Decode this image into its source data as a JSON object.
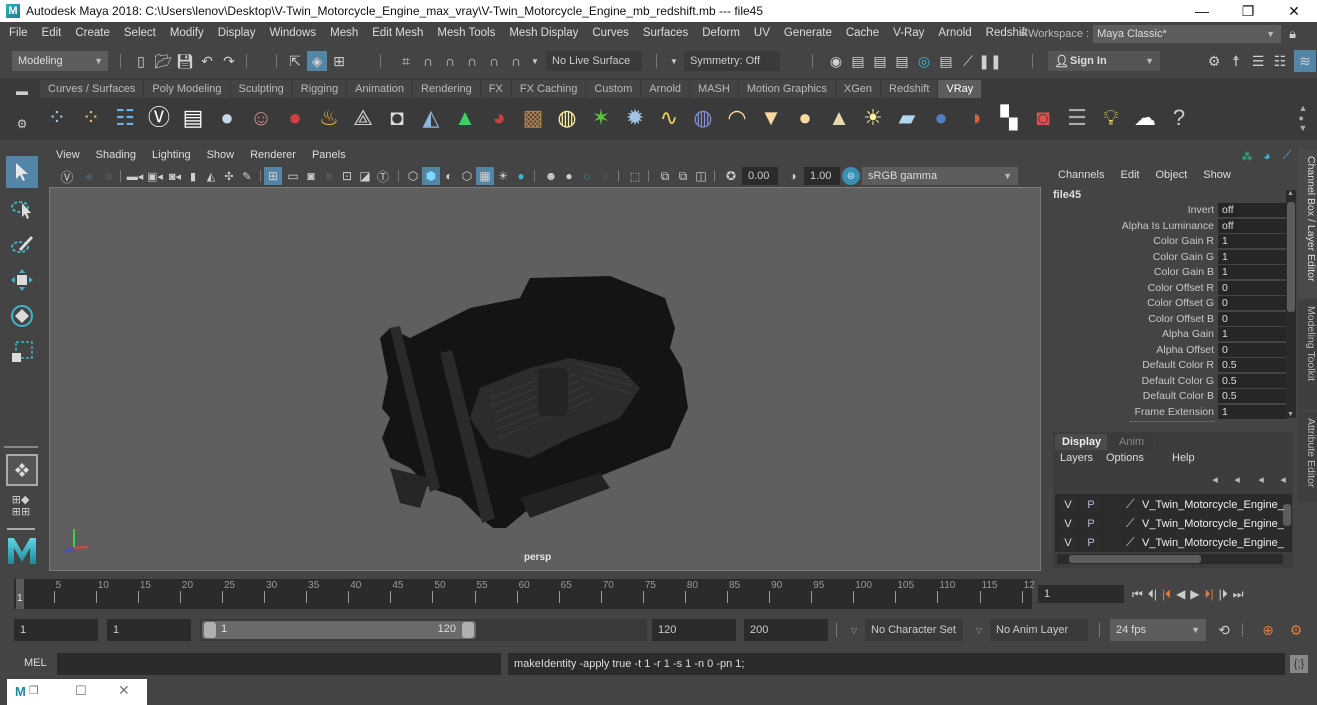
{
  "window": {
    "title": "Autodesk Maya 2018: C:\\Users\\lenov\\Desktop\\V-Twin_Motorcycle_Engine_max_vray\\V-Twin_Motorcycle_Engine_mb_redshift.mb  ---  file45",
    "minimize": "—",
    "restore": "❐",
    "close": "✕"
  },
  "menubar": {
    "items": [
      "File",
      "Edit",
      "Create",
      "Select",
      "Modify",
      "Display",
      "Windows",
      "Mesh",
      "Edit Mesh",
      "Mesh Tools",
      "Mesh Display",
      "Curves",
      "Surfaces",
      "Deform",
      "UV",
      "Generate",
      "Cache",
      "V-Ray",
      "Arnold",
      "Redshift"
    ],
    "workspace_label": "Workspace :",
    "workspace_value": "Maya Classic*"
  },
  "statusline": {
    "mode": "Modeling",
    "live_surface": "No Live Surface",
    "symmetry": "Symmetry: Off",
    "sign_in": "Sign In"
  },
  "shelf": {
    "tabs": [
      "Curves / Surfaces",
      "Poly Modeling",
      "Sculpting",
      "Rigging",
      "Animation",
      "Rendering",
      "FX",
      "FX Caching",
      "Custom",
      "Arnold",
      "MASH",
      "Motion Graphics",
      "XGen",
      "Redshift",
      "VRay"
    ],
    "active_tab": "VRay",
    "icons": [
      "vray-save-icon",
      "vray-open-icon",
      "vray-settings-icon",
      "vray-logo-icon",
      "vray-frame-buffer-icon",
      "vray-material-icon",
      "vray-camera-icon",
      "vray-blend-mtl-icon",
      "vray-fire-icon",
      "vray-proxy-icon",
      "vray-light-select-icon",
      "vray-displacement-icon",
      "vray-env-fog-icon",
      "vray-fur-icon",
      "vray-texture-icon",
      "vray-dome-light-icon",
      "vray-grass-icon",
      "vray-particles-icon",
      "vray-hair-icon",
      "vray-sphere-light-icon",
      "vray-rect-light-icon",
      "vray-spot-light-icon",
      "vray-ies-light-icon",
      "vray-cone-light-icon",
      "vray-sun-icon",
      "vray-plane-light-icon",
      "vray-sphere-icon",
      "vray-toon-icon",
      "vray-checker-icon",
      "vray-render-icon",
      "vray-render-settings-icon",
      "vray-light-lister-icon",
      "vray-cloud-icon",
      "vray-help-icon"
    ]
  },
  "viewport": {
    "menus": [
      "View",
      "Shading",
      "Lighting",
      "Show",
      "Renderer",
      "Panels"
    ],
    "exposure": "0.00",
    "gamma": "1.00",
    "color_space": "sRGB gamma",
    "camera_label": "persp"
  },
  "channel_box": {
    "menus": [
      "Channels",
      "Edit",
      "Object",
      "Show"
    ],
    "node_name": "file45",
    "attributes": [
      {
        "label": "Invert",
        "value": "off"
      },
      {
        "label": "Alpha Is Luminance",
        "value": "off"
      },
      {
        "label": "Color Gain R",
        "value": "1"
      },
      {
        "label": "Color Gain G",
        "value": "1"
      },
      {
        "label": "Color Gain B",
        "value": "1"
      },
      {
        "label": "Color Offset R",
        "value": "0"
      },
      {
        "label": "Color Offset G",
        "value": "0"
      },
      {
        "label": "Color Offset B",
        "value": "0"
      },
      {
        "label": "Alpha Gain",
        "value": "1"
      },
      {
        "label": "Alpha Offset",
        "value": "0"
      },
      {
        "label": "Default Color R",
        "value": "0.5"
      },
      {
        "label": "Default Color G",
        "value": "0.5"
      },
      {
        "label": "Default Color B",
        "value": "0.5"
      },
      {
        "label": "Frame Extension",
        "value": "1"
      }
    ]
  },
  "side_tabs": [
    "Channel Box / Layer Editor",
    "Modeling Toolkit",
    "Attribute Editor"
  ],
  "layer_editor": {
    "tabs": [
      "Display",
      "Anim"
    ],
    "active_tab": "Display",
    "menus": [
      "Layers",
      "Options",
      "Help"
    ],
    "layers": [
      {
        "v": "V",
        "p": "P",
        "name": "V_Twin_Motorcycle_Engine_"
      },
      {
        "v": "V",
        "p": "P",
        "name": "V_Twin_Motorcycle_Engine_"
      },
      {
        "v": "V",
        "p": "P",
        "name": "V_Twin_Motorcycle_Engine_"
      }
    ]
  },
  "timeline": {
    "ticks": [
      "5",
      "10",
      "15",
      "20",
      "25",
      "30",
      "35",
      "40",
      "45",
      "50",
      "55",
      "60",
      "65",
      "70",
      "75",
      "80",
      "85",
      "90",
      "95",
      "100",
      "105",
      "110",
      "115",
      "12"
    ],
    "current_frame_marker": "1",
    "current_frame": "1"
  },
  "range": {
    "start": "1",
    "playback_start": "1",
    "slider_min": "1",
    "slider_max": "120",
    "playback_end": "120",
    "end": "200",
    "character_set": "No Character Set",
    "anim_layer": "No Anim Layer",
    "fps": "24 fps"
  },
  "command_line": {
    "lang": "MEL",
    "input": "",
    "result": "makeIdentity -apply true -t 1 -r 1 -s 1 -n 0 -pn 1;"
  },
  "taskbar": {
    "app": "M"
  },
  "colors": {
    "accent": "#5285a6",
    "panel_bg": "#444444",
    "viewport_bg": "#5f5f5f",
    "field_bg": "#2b2b2b",
    "active_tab": "#5d5d5d",
    "key_marker": "#e07a3c"
  }
}
